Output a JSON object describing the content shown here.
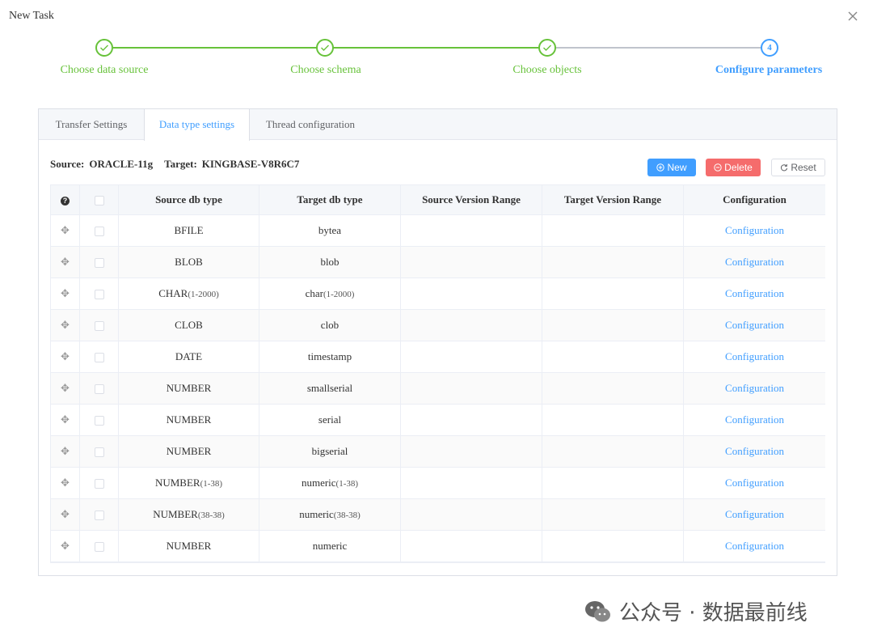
{
  "window": {
    "title": "New Task"
  },
  "steps": [
    {
      "label": "Choose data source",
      "state": "done"
    },
    {
      "label": "Choose schema",
      "state": "done"
    },
    {
      "label": "Choose objects",
      "state": "done"
    },
    {
      "label": "Configure parameters",
      "state": "active",
      "number": "4"
    }
  ],
  "tabs": [
    {
      "label": "Transfer Settings",
      "active": false
    },
    {
      "label": "Data type settings",
      "active": true
    },
    {
      "label": "Thread configuration",
      "active": false
    }
  ],
  "source": {
    "label": "Source:",
    "value": "ORACLE-11g"
  },
  "target": {
    "label": "Target:",
    "value": "KINGBASE-V8R6C7"
  },
  "buttons": {
    "new": "New",
    "delete": "Delete",
    "reset": "Reset"
  },
  "table": {
    "headers": {
      "source_type": "Source db type",
      "target_type": "Target db type",
      "source_range": "Source Version Range",
      "target_range": "Target Version Range",
      "configuration": "Configuration"
    },
    "rows": [
      {
        "src": "BFILE",
        "src_sub": "",
        "tgt": "bytea",
        "tgt_sub": "",
        "src_range": "",
        "tgt_range": "",
        "config": "Configuration"
      },
      {
        "src": "BLOB",
        "src_sub": "",
        "tgt": "blob",
        "tgt_sub": "",
        "src_range": "",
        "tgt_range": "",
        "config": "Configuration"
      },
      {
        "src": "CHAR",
        "src_sub": "(1-2000)",
        "tgt": "char",
        "tgt_sub": "(1-2000)",
        "src_range": "",
        "tgt_range": "",
        "config": "Configuration"
      },
      {
        "src": "CLOB",
        "src_sub": "",
        "tgt": "clob",
        "tgt_sub": "",
        "src_range": "",
        "tgt_range": "",
        "config": "Configuration"
      },
      {
        "src": "DATE",
        "src_sub": "",
        "tgt": "timestamp",
        "tgt_sub": "",
        "src_range": "",
        "tgt_range": "",
        "config": "Configuration"
      },
      {
        "src": "NUMBER",
        "src_sub": "",
        "tgt": "smallserial",
        "tgt_sub": "",
        "src_range": "",
        "tgt_range": "",
        "config": "Configuration"
      },
      {
        "src": "NUMBER",
        "src_sub": "",
        "tgt": "serial",
        "tgt_sub": "",
        "src_range": "",
        "tgt_range": "",
        "config": "Configuration"
      },
      {
        "src": "NUMBER",
        "src_sub": "",
        "tgt": "bigserial",
        "tgt_sub": "",
        "src_range": "",
        "tgt_range": "",
        "config": "Configuration"
      },
      {
        "src": "NUMBER",
        "src_sub": "(1-38)",
        "tgt": "numeric",
        "tgt_sub": "(1-38)",
        "src_range": "",
        "tgt_range": "",
        "config": "Configuration"
      },
      {
        "src": "NUMBER",
        "src_sub": "(38-38)",
        "tgt": "numeric",
        "tgt_sub": "(38-38)",
        "src_range": "",
        "tgt_range": "",
        "config": "Configuration"
      },
      {
        "src": "NUMBER",
        "src_sub": "",
        "tgt": "numeric",
        "tgt_sub": "",
        "src_range": "",
        "tgt_range": "",
        "config": "Configuration"
      }
    ]
  },
  "watermark": {
    "text": "公众号 · 数据最前线"
  },
  "colors": {
    "done": "#67c23a",
    "active": "#409eff",
    "danger": "#f56c6c",
    "pending_line": "#c0c4cc"
  },
  "icons": {
    "close": "close-icon",
    "done": "check-icon",
    "drag": "drag-icon",
    "help": "help-icon",
    "new": "plus-circle-icon",
    "delete": "minus-circle-icon",
    "reset": "refresh-icon",
    "watermark": "wechat-icon"
  }
}
